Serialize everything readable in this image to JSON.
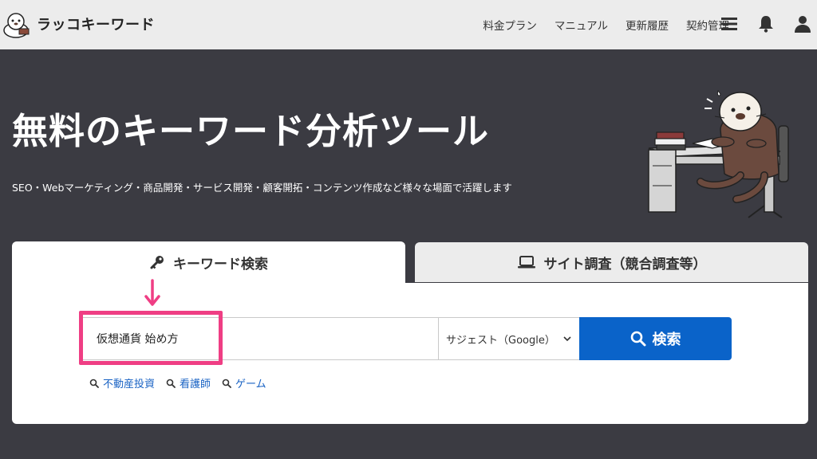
{
  "header": {
    "logo_text": "ラッコキーワード",
    "nav": [
      "料金プラン",
      "マニュアル",
      "更新履歴",
      "契約管理"
    ],
    "icons": [
      "menu-icon",
      "bell-icon",
      "user-icon"
    ]
  },
  "hero": {
    "title": "無料のキーワード分析ツール",
    "subtitle": "SEO・Webマーケティング・商品開発・サービス開発・顧客開拓・コンテンツ作成など様々な場面で活躍します"
  },
  "tabs": {
    "keyword": "キーワード検索",
    "site": "サイト調査（競合調査等）"
  },
  "search": {
    "value": "仮想通貨 始め方",
    "select_value": "サジェスト（Google）",
    "button_label": "検索"
  },
  "suggestions": [
    "不動産投資",
    "看護師",
    "ゲーム"
  ],
  "colors": {
    "background": "#3b3b42",
    "header": "#ececec",
    "accent_blue": "#0a63c9",
    "highlight_pink": "#ef3e84",
    "link_blue": "#1a63c4"
  }
}
